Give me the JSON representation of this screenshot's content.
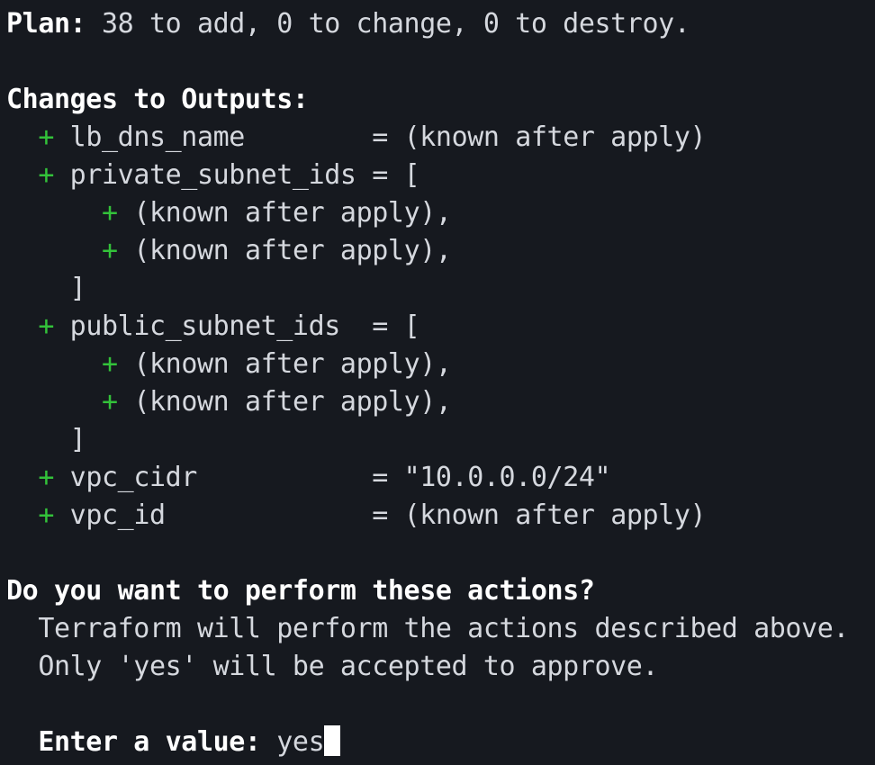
{
  "plan": {
    "label": "Plan:",
    "summary": " 38 to add, 0 to change, 0 to destroy."
  },
  "outputs_header": "Changes to Outputs:",
  "plus_sign": "+",
  "outputs": {
    "lb_dns_name": {
      "name": "lb_dns_name",
      "pad": "        ",
      "eq": "= ",
      "value": "(known after apply)"
    },
    "private_subnet_ids": {
      "name": "private_subnet_ids",
      "pad": " ",
      "eq": "= ",
      "open": "[",
      "items": [
        "(known after apply),",
        "(known after apply),"
      ],
      "close": "]"
    },
    "public_subnet_ids": {
      "name": "public_subnet_ids",
      "pad": "  ",
      "eq": "= ",
      "open": "[",
      "items": [
        "(known after apply),",
        "(known after apply),"
      ],
      "close": "]"
    },
    "vpc_cidr": {
      "name": "vpc_cidr",
      "pad": "           ",
      "eq": "= ",
      "value": "\"10.0.0.0/24\""
    },
    "vpc_id": {
      "name": "vpc_id",
      "pad": "             ",
      "eq": "= ",
      "value": "(known after apply)"
    }
  },
  "prompt": {
    "question": "Do you want to perform these actions?",
    "line1": "  Terraform will perform the actions described above.",
    "line2": "  Only 'yes' will be accepted to approve.",
    "label": "  Enter a value:",
    "input_value": " yes"
  },
  "colors": {
    "background": "#16191f",
    "text": "#d5d8de",
    "bold_text": "#ffffff",
    "plus": "#33c23a",
    "cursor": "#ffffff"
  }
}
